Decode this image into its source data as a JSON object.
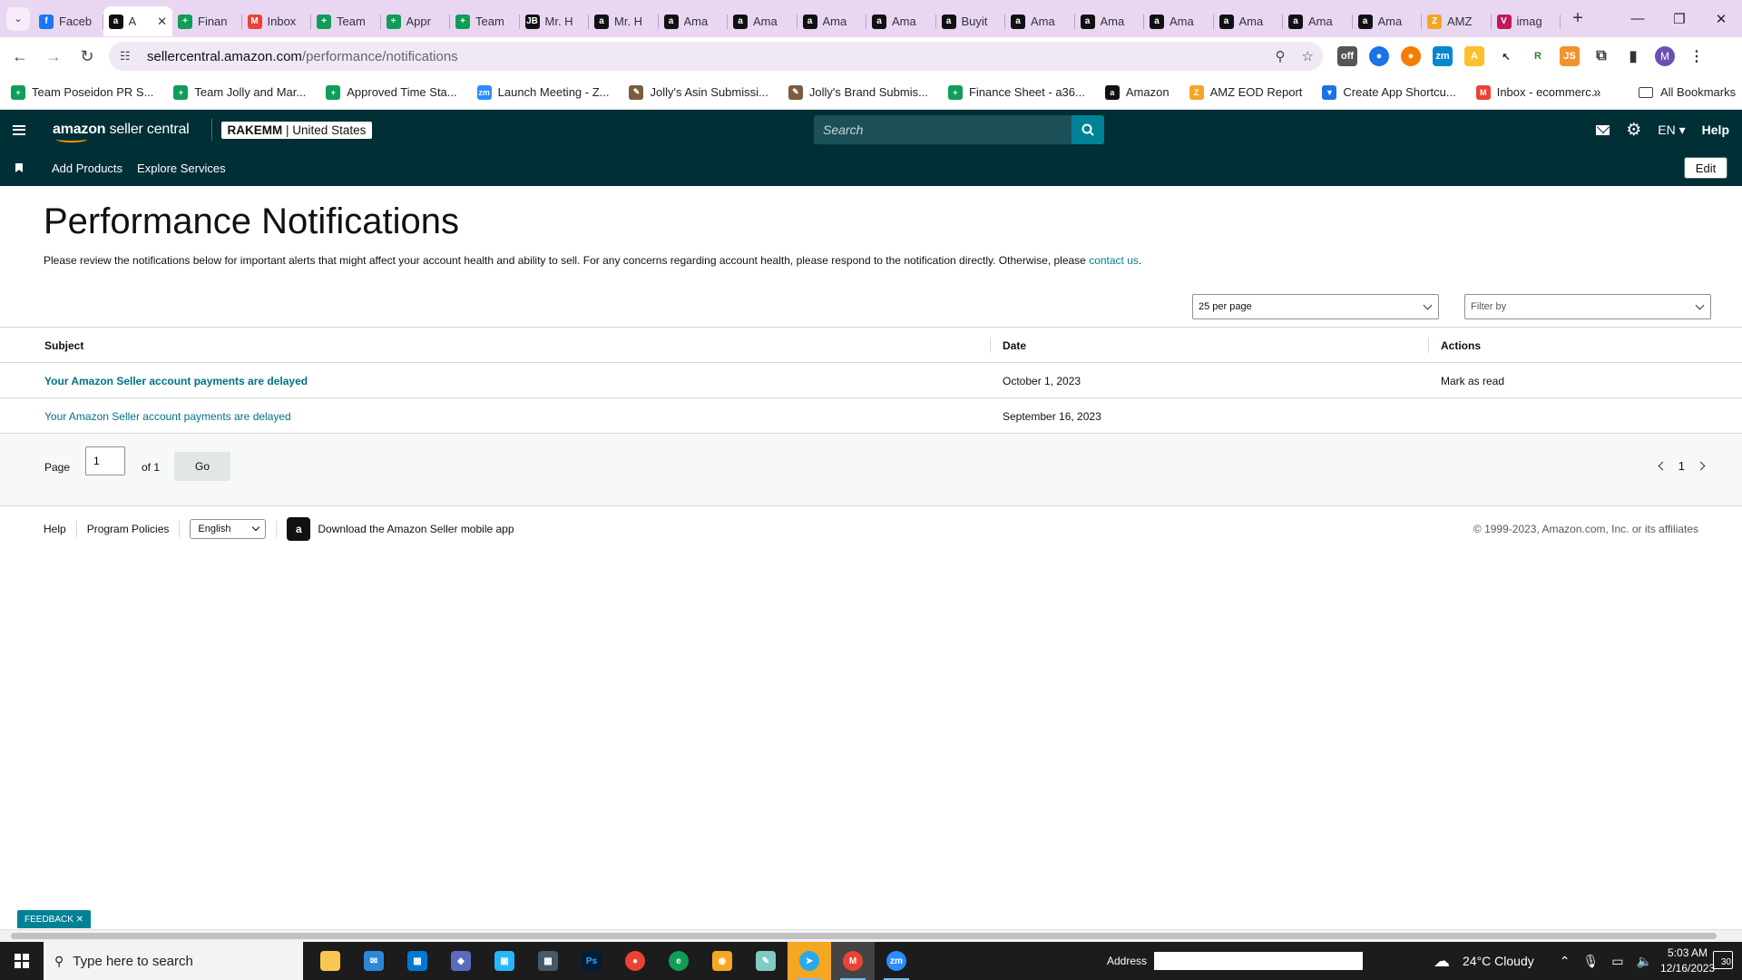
{
  "browser": {
    "tabs": [
      {
        "label": "Faceb",
        "color": "#1877f2",
        "glyph": "f"
      },
      {
        "label": "A",
        "color": "#111111",
        "glyph": "a",
        "active": true
      },
      {
        "label": "Finan",
        "color": "#0f9d58",
        "glyph": "+"
      },
      {
        "label": "Inbox",
        "color": "#ea4335",
        "glyph": "M"
      },
      {
        "label": "Team",
        "color": "#0f9d58",
        "glyph": "+"
      },
      {
        "label": "Appr",
        "color": "#0f9d58",
        "glyph": "+"
      },
      {
        "label": "Team",
        "color": "#0f9d58",
        "glyph": "+"
      },
      {
        "label": "Mr. H",
        "color": "#111111",
        "glyph": "JB"
      },
      {
        "label": "Mr. H",
        "color": "#111111",
        "glyph": "a"
      },
      {
        "label": "Ama",
        "color": "#111111",
        "glyph": "a"
      },
      {
        "label": "Ama",
        "color": "#111111",
        "glyph": "a"
      },
      {
        "label": "Ama",
        "color": "#111111",
        "glyph": "a"
      },
      {
        "label": "Ama",
        "color": "#111111",
        "glyph": "a"
      },
      {
        "label": "Buyit",
        "color": "#111111",
        "glyph": "a"
      },
      {
        "label": "Ama",
        "color": "#111111",
        "glyph": "a"
      },
      {
        "label": "Ama",
        "color": "#111111",
        "glyph": "a"
      },
      {
        "label": "Ama",
        "color": "#111111",
        "glyph": "a"
      },
      {
        "label": "Ama",
        "color": "#111111",
        "glyph": "a"
      },
      {
        "label": "Ama",
        "color": "#111111",
        "glyph": "a"
      },
      {
        "label": "Ama",
        "color": "#111111",
        "glyph": "a"
      },
      {
        "label": "AMZ",
        "color": "#f5a623",
        "glyph": "Z"
      },
      {
        "label": "imag",
        "color": "#c2185b",
        "glyph": "V"
      }
    ],
    "url_host": "sellercentral.amazon.com",
    "url_path": "/performance/notifications",
    "bookmarks": [
      {
        "label": "Team Poseidon PR S...",
        "color": "#0f9d58",
        "glyph": "+"
      },
      {
        "label": "Team Jolly and Mar...",
        "color": "#0f9d58",
        "glyph": "+"
      },
      {
        "label": "Approved Time Sta...",
        "color": "#0f9d58",
        "glyph": "+"
      },
      {
        "label": "Launch Meeting - Z...",
        "color": "#2d8cff",
        "glyph": "zm"
      },
      {
        "label": "Jolly's Asin Submissi...",
        "color": "#7a5c3e",
        "glyph": "✎"
      },
      {
        "label": "Jolly's Brand Submis...",
        "color": "#7a5c3e",
        "glyph": "✎"
      },
      {
        "label": "Finance Sheet - a36...",
        "color": "#0f9d58",
        "glyph": "+"
      },
      {
        "label": "Amazon",
        "color": "#111111",
        "glyph": "a"
      },
      {
        "label": "AMZ EOD Report",
        "color": "#f5a623",
        "glyph": "Z"
      },
      {
        "label": "Create App Shortcu...",
        "color": "#1a73e8",
        "glyph": "▼"
      },
      {
        "label": "Inbox - ecommerc...",
        "color": "#ea4335",
        "glyph": "M"
      }
    ],
    "all_bookmarks": "All Bookmarks",
    "more_bookmarks": "»"
  },
  "header": {
    "logo_bold": "amazon",
    "logo_rest": " seller central",
    "store_name": "RAKEMM",
    "store_region": " | United States",
    "search_placeholder": "Search",
    "language": "EN ▾",
    "help": "Help",
    "sub_links": [
      "Add Products",
      "Explore Services"
    ],
    "edit": "Edit"
  },
  "main": {
    "title": "Performance Notifications",
    "intro": "Please review the notifications below for important alerts that might affect your account health and ability to sell. For any concerns regarding account health, please respond to the notification directly. Otherwise, please ",
    "intro_link": "contact us",
    "intro_end": ".",
    "per_page": "25 per page",
    "filter": "Filter by",
    "columns": {
      "subject": "Subject",
      "date": "Date",
      "actions": "Actions"
    },
    "rows": [
      {
        "subject": "Your Amazon Seller account payments are delayed",
        "date": "October 1, 2023",
        "action": "Mark as read",
        "unread": true
      },
      {
        "subject": "Your Amazon Seller account payments are delayed",
        "date": "September 16, 2023",
        "action": "",
        "unread": false
      }
    ],
    "pager": {
      "label": "Page",
      "value": "1",
      "of": "of 1",
      "go": "Go",
      "current": "1"
    }
  },
  "footer": {
    "help": "Help",
    "policies": "Program Policies",
    "language": "English",
    "app": "Download the Amazon Seller mobile app",
    "copyright": "© 1999-2023, Amazon.com, Inc. or its affiliates"
  },
  "feedback": "FEEDBACK ✕",
  "taskbar": {
    "search": "Type here to search",
    "address": "Address",
    "weather": "24°C  Cloudy",
    "time": "5:03 AM",
    "date": "12/16/2023",
    "notifications": "30"
  }
}
